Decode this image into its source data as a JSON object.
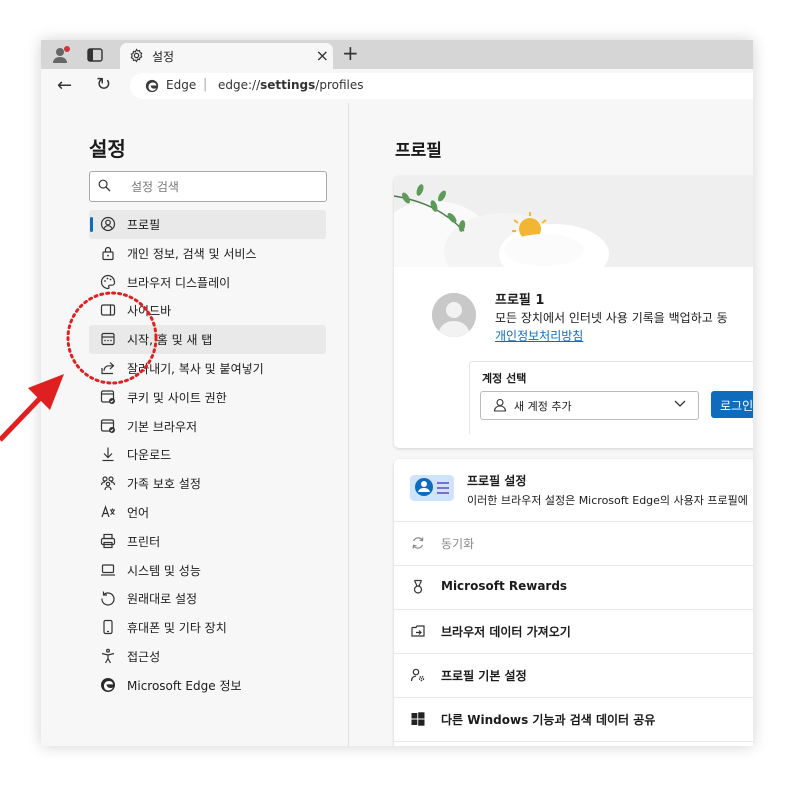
{
  "tabstrip": {
    "tab_title": "설정",
    "close_glyph": "×",
    "newtab_glyph": "+"
  },
  "toolbar": {
    "back_glyph": "←",
    "reload_glyph": "↻",
    "site_label": "Edge",
    "separator": "|",
    "url_prefix": "edge://",
    "url_bold": "settings",
    "url_suffix": "/profiles"
  },
  "sidebar": {
    "title": "설정",
    "search_placeholder": "설정 검색",
    "items": [
      {
        "label": "프로필",
        "icon": "profile-icon",
        "active": true
      },
      {
        "label": "개인 정보, 검색 및 서비스",
        "icon": "lock-icon"
      },
      {
        "label": "브라우저 디스플레이",
        "icon": "palette-icon"
      },
      {
        "label": "사이드바",
        "icon": "sidebar-icon"
      },
      {
        "label": "시작, 홈 및 새 탭",
        "icon": "start-home-icon",
        "hover": true
      },
      {
        "label": "잘라내기, 복사 및 붙여넣기",
        "icon": "share-icon"
      },
      {
        "label": "쿠키 및 사이트 권한",
        "icon": "cookie-icon"
      },
      {
        "label": "기본 브라우저",
        "icon": "browser-icon"
      },
      {
        "label": "다운로드",
        "icon": "download-icon"
      },
      {
        "label": "가족 보호 설정",
        "icon": "family-icon"
      },
      {
        "label": "언어",
        "icon": "language-icon"
      },
      {
        "label": "프린터",
        "icon": "printer-icon"
      },
      {
        "label": "시스템 및 성능",
        "icon": "laptop-icon"
      },
      {
        "label": "원래대로 설정",
        "icon": "reset-icon"
      },
      {
        "label": "휴대폰 및 기타 장치",
        "icon": "phone-icon"
      },
      {
        "label": "접근성",
        "icon": "accessibility-icon"
      },
      {
        "label": "Microsoft Edge 정보",
        "icon": "edge-icon"
      }
    ]
  },
  "main": {
    "title": "프로필",
    "profile": {
      "name": "프로필 1",
      "description": "모든 장치에서 인터넷 사용 기록을 백업하고 동",
      "link": "개인정보처리방침"
    },
    "account": {
      "label": "계정 선택",
      "select_value": "새 계정 추가",
      "login_label": "로그인"
    },
    "profile_settings": {
      "title": "프로필 설정",
      "description": "이러한 브라우저 설정은 Microsoft Edge의 사용자 프로필에"
    },
    "rows": [
      {
        "label": "동기화",
        "icon": "sync-icon",
        "disabled": true
      },
      {
        "label": "Microsoft Rewards",
        "icon": "rewards-icon"
      },
      {
        "label": "브라우저 데이터 가져오기",
        "icon": "import-icon"
      },
      {
        "label": "프로필 기본 설정",
        "icon": "profile-preferences-icon"
      },
      {
        "label": "다른 Windows 기능과 검색 데이터 공유",
        "icon": "windows-icon"
      }
    ]
  },
  "annotation": {
    "circle_color": "#e02020",
    "arrow_color": "#e02020"
  },
  "colors": {
    "accent": "#0f6cbd",
    "tabstrip": "#d6d6d6",
    "background": "#f7f7f7"
  }
}
